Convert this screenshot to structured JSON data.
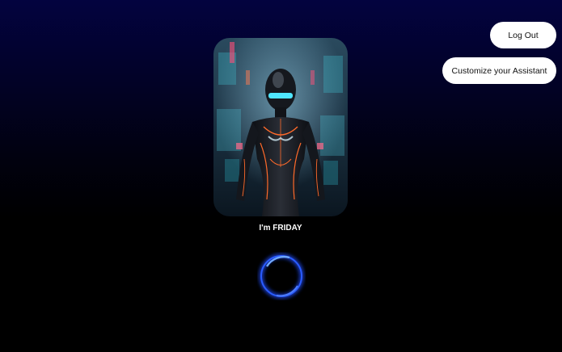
{
  "header": {
    "logout_label": "Log Out",
    "customize_label": "Customize your Assistant"
  },
  "assistant": {
    "name_label": "I'm FRIDAY",
    "portrait_icon": "cyber-android-portrait",
    "voice_indicator_icon": "voice-ring-icon"
  },
  "colors": {
    "background_top": "#03033f",
    "background_bottom": "#000000",
    "button_bg": "#ffffff",
    "ring_accent": "#2a5cff"
  }
}
